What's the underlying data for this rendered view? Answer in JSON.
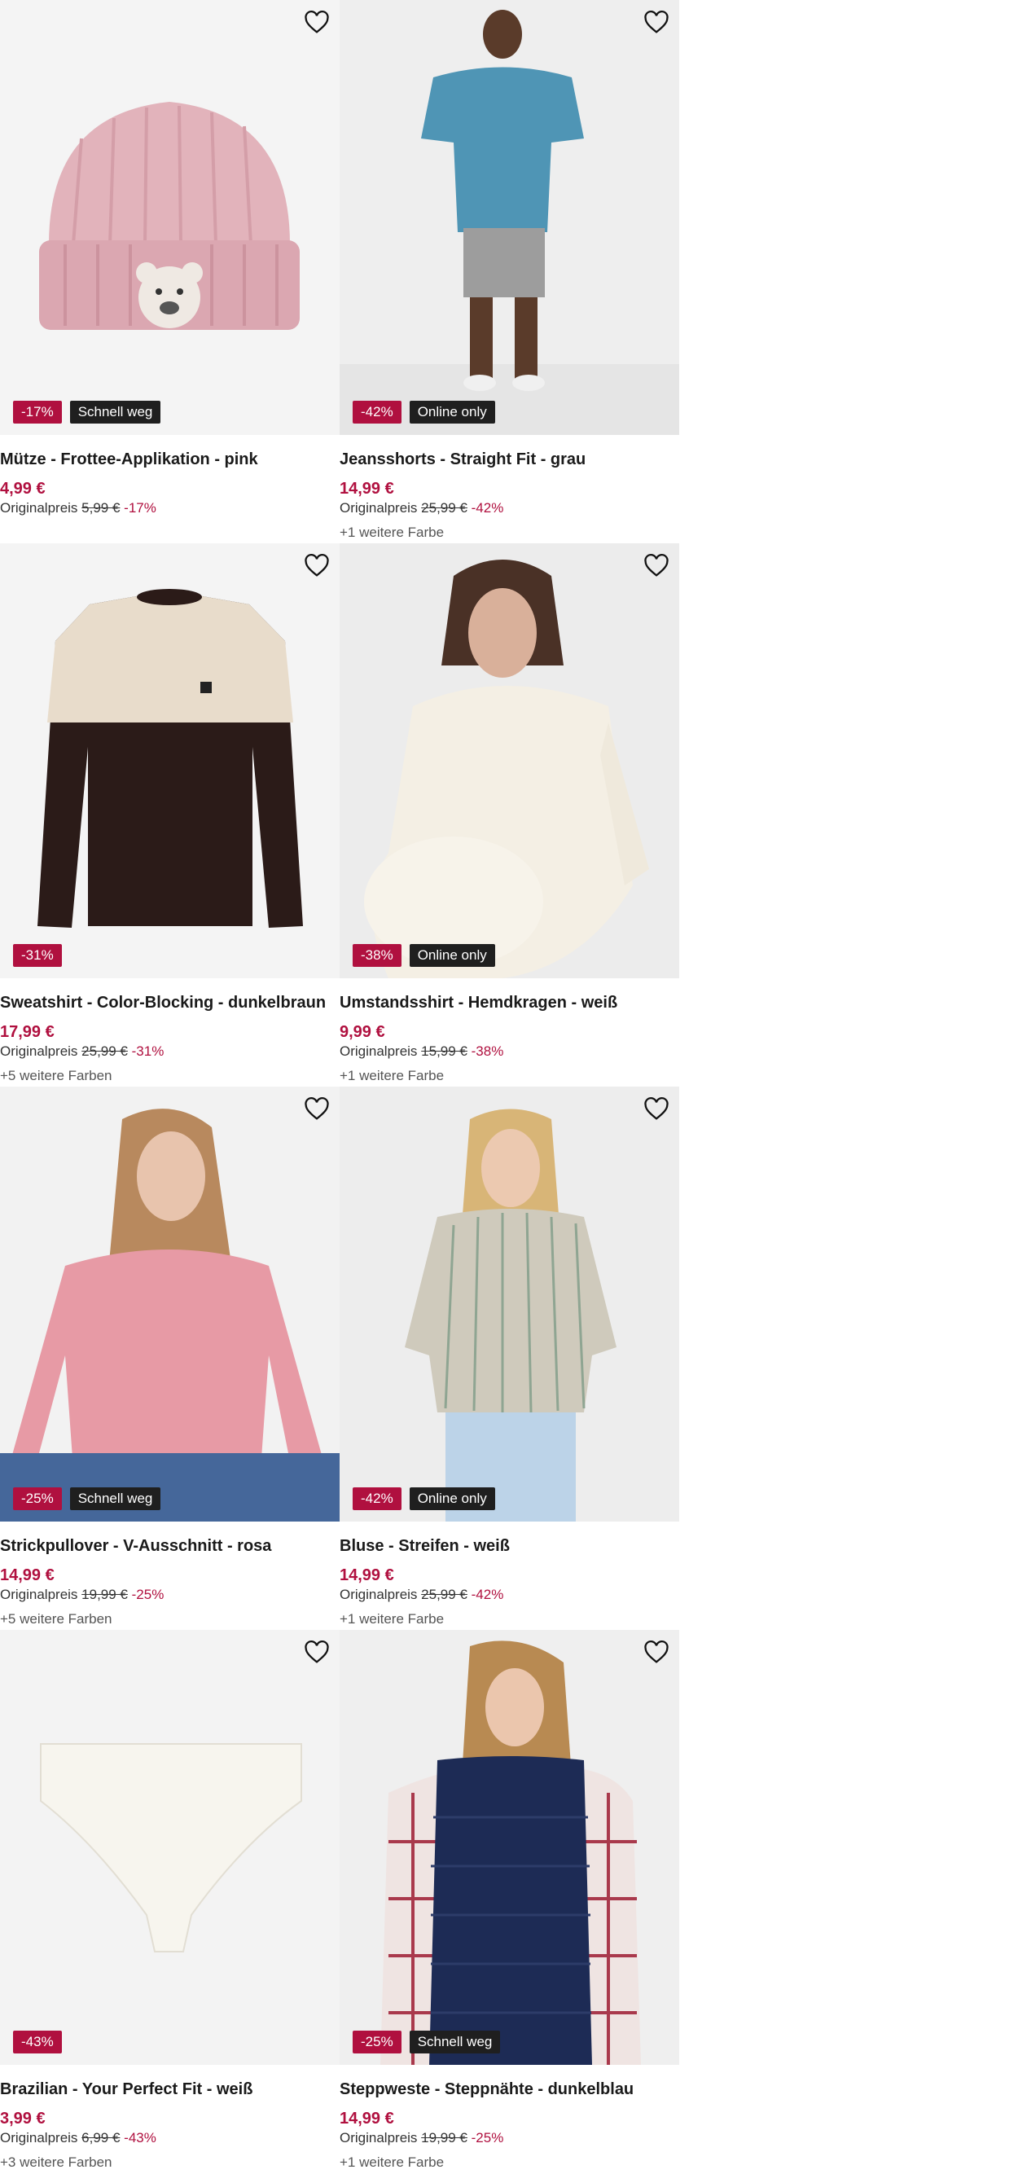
{
  "products": [
    {
      "title": "Mütze - Frottee-Applikation - pink",
      "price": "4,99 €",
      "orig_label": "Originalpreis",
      "orig_price": "5,99 €",
      "discount": "-17%",
      "tag": "Schnell weg",
      "more_colors": ""
    },
    {
      "title": "Jeansshorts - Straight Fit - grau",
      "price": "14,99 €",
      "orig_label": "Originalpreis",
      "orig_price": "25,99 €",
      "discount": "-42%",
      "tag": "Online only",
      "more_colors": "+1 weitere Farbe"
    },
    {
      "title": "Sweatshirt - Color-Blocking - dunkelbraun",
      "price": "17,99 €",
      "orig_label": "Originalpreis",
      "orig_price": "25,99 €",
      "discount": "-31%",
      "tag": "",
      "more_colors": "+5 weitere Farben"
    },
    {
      "title": "Umstandsshirt - Hemdkragen - weiß",
      "price": "9,99 €",
      "orig_label": "Originalpreis",
      "orig_price": "15,99 €",
      "discount": "-38%",
      "tag": "Online only",
      "more_colors": "+1 weitere Farbe"
    },
    {
      "title": "Strickpullover - V-Ausschnitt - rosa",
      "price": "14,99 €",
      "orig_label": "Originalpreis",
      "orig_price": "19,99 €",
      "discount": "-25%",
      "tag": "Schnell weg",
      "more_colors": "+5 weitere Farben"
    },
    {
      "title": "Bluse - Streifen - weiß",
      "price": "14,99 €",
      "orig_label": "Originalpreis",
      "orig_price": "25,99 €",
      "discount": "-42%",
      "tag": "Online only",
      "more_colors": "+1 weitere Farbe"
    },
    {
      "title": "Brazilian - Your Perfect Fit - weiß",
      "price": "3,99 €",
      "orig_label": "Originalpreis",
      "orig_price": "6,99 €",
      "discount": "-43%",
      "tag": "",
      "more_colors": "+3 weitere Farben"
    },
    {
      "title": "Steppweste - Steppnähte - dunkelblau",
      "price": "14,99 €",
      "orig_label": "Originalpreis",
      "orig_price": "19,99 €",
      "discount": "-25%",
      "tag": "Schnell weg",
      "more_colors": "+1 weitere Farbe"
    }
  ],
  "colors": {
    "accent": "#b0103f",
    "tag_bg": "#1f1f1f",
    "image_bg": "#f2f2f2"
  },
  "icons": {
    "favorite": "heart-outline-icon"
  }
}
